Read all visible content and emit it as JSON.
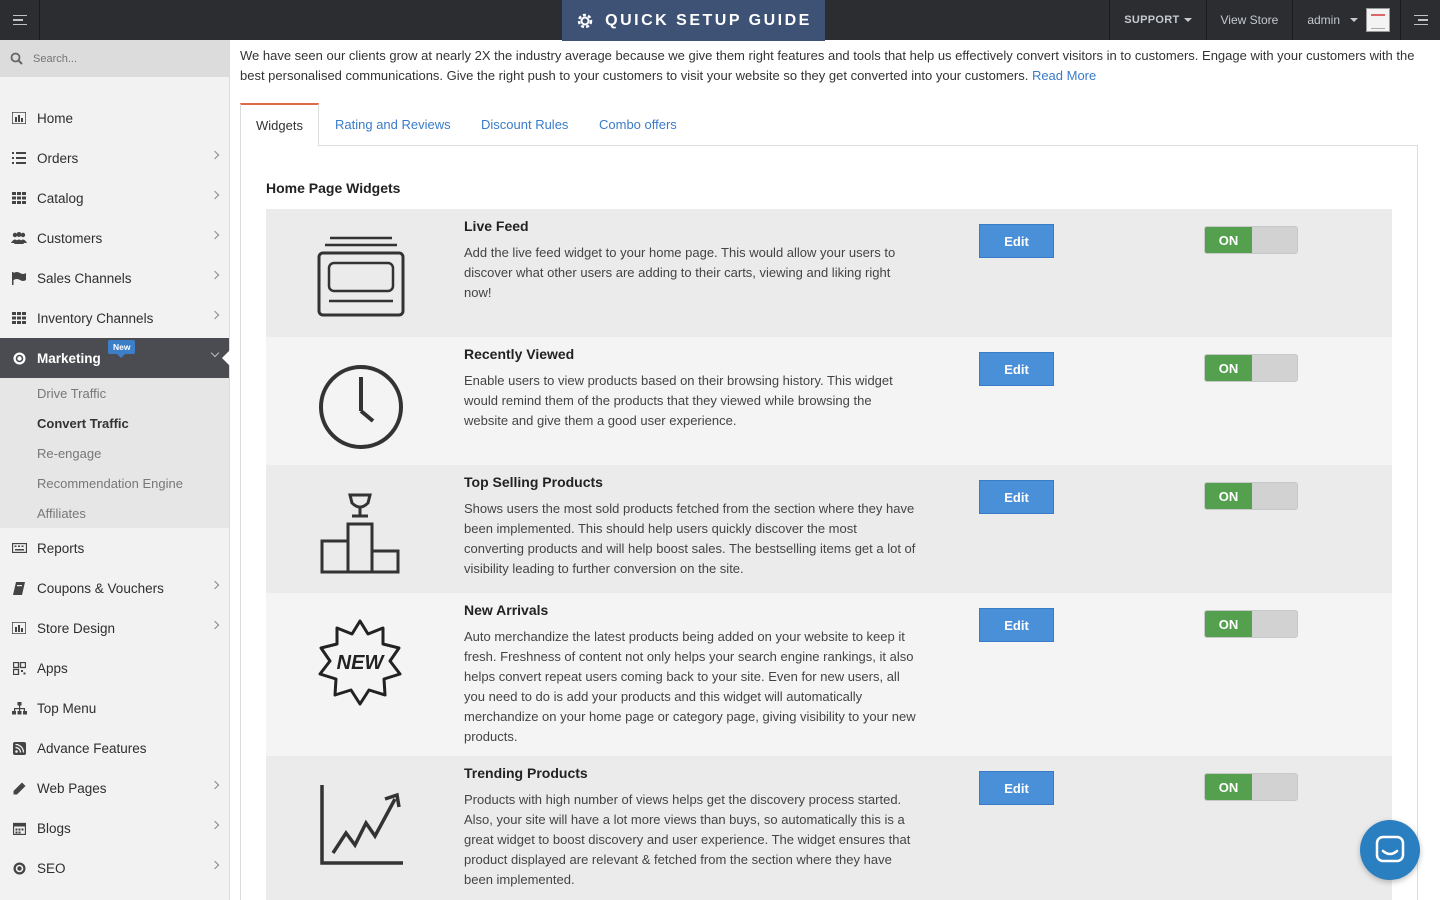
{
  "topbar": {
    "guide_label": "QUICK SETUP GUIDE",
    "support_label": "SUPPORT",
    "view_store_label": "View Store",
    "user_label": "admin"
  },
  "sidebar": {
    "search_placeholder": "Search...",
    "items": [
      {
        "label": "Home",
        "icon": "bar-chart-icon"
      },
      {
        "label": "Orders",
        "icon": "list-icon"
      },
      {
        "label": "Catalog",
        "icon": "grid-icon"
      },
      {
        "label": "Customers",
        "icon": "users-icon"
      },
      {
        "label": "Sales Channels",
        "icon": "flag-icon"
      },
      {
        "label": "Inventory Channels",
        "icon": "grid-icon"
      },
      {
        "label": "Marketing",
        "icon": "compass-icon",
        "badge": "New"
      },
      {
        "label": "Reports",
        "icon": "keyboard-icon"
      },
      {
        "label": "Coupons & Vouchers",
        "icon": "book-icon"
      },
      {
        "label": "Store Design",
        "icon": "bar-chart-icon"
      },
      {
        "label": "Apps",
        "icon": "qr-icon"
      },
      {
        "label": "Top Menu",
        "icon": "sitemap-icon"
      },
      {
        "label": "Advance Features",
        "icon": "rss-icon"
      },
      {
        "label": "Web Pages",
        "icon": "pencil-icon"
      },
      {
        "label": "Blogs",
        "icon": "calendar-icon"
      },
      {
        "label": "SEO",
        "icon": "compass-icon"
      }
    ],
    "marketing_sub": [
      "Drive Traffic",
      "Convert Traffic",
      "Re-engage",
      "Recommendation Engine",
      "Affiliates"
    ]
  },
  "intro": {
    "text": "We have seen our clients grow at nearly 2X the industry average because we give them right features and tools that help us effectively convert visitors in to customers. Engage with your customers with the best personalised communications. Give the right push to your customers to  visit your website so they get converted into your customers. ",
    "link": "Read More"
  },
  "tabs": [
    "Widgets",
    "Rating and Reviews",
    "Discount Rules",
    "Combo offers"
  ],
  "section_title": "Home Page Widgets",
  "widgets": [
    {
      "title": "Live Feed",
      "desc": "Add the live feed widget to your home page. This would allow your users to discover what other users are adding to their carts, viewing and liking right now!",
      "edit": "Edit",
      "toggle": "ON",
      "icon": "live-feed-icon"
    },
    {
      "title": "Recently Viewed",
      "desc": "Enable users to view products based on their browsing history. This widget would remind them of the products that they viewed while browsing the website and give them a good user experience.",
      "edit": "Edit",
      "toggle": "ON",
      "icon": "clock-icon"
    },
    {
      "title": "Top Selling Products",
      "desc": "Shows users the most sold products fetched from the section where they have been implemented. This should help users quickly discover the most converting products and will help boost sales. The bestselling items get a lot of visibility leading to further conversion on the site.",
      "edit": "Edit",
      "toggle": "ON",
      "icon": "podium-icon"
    },
    {
      "title": "New Arrivals",
      "desc": "Auto merchandize the latest products being added on your website to keep it fresh. Freshness of content not only helps your search engine rankings, it also helps convert repeat users coming back to your site. Even for new users, all you need to do is add your products and this widget will automatically merchandize on your home page or category page, giving visibility to your new products.",
      "edit": "Edit",
      "toggle": "ON",
      "icon": "new-badge-icon",
      "icon_text": "NEW"
    },
    {
      "title": "Trending Products",
      "desc": "Products with high number of views helps get the discovery process started. Also, your site will have a lot more views than buys, so automatically this is a great widget to boost discovery and user experience. The widget ensures that product displayed are relevant & fetched from the section where they have been implemented.",
      "edit": "Edit",
      "toggle": "ON",
      "icon": "trend-chart-icon"
    }
  ],
  "colors": {
    "accent": "#4a90d9",
    "on_green": "#55a04e",
    "topbar": "#2b2d31",
    "guide_bg": "#3d5275",
    "active_tab": "#e06a45"
  }
}
